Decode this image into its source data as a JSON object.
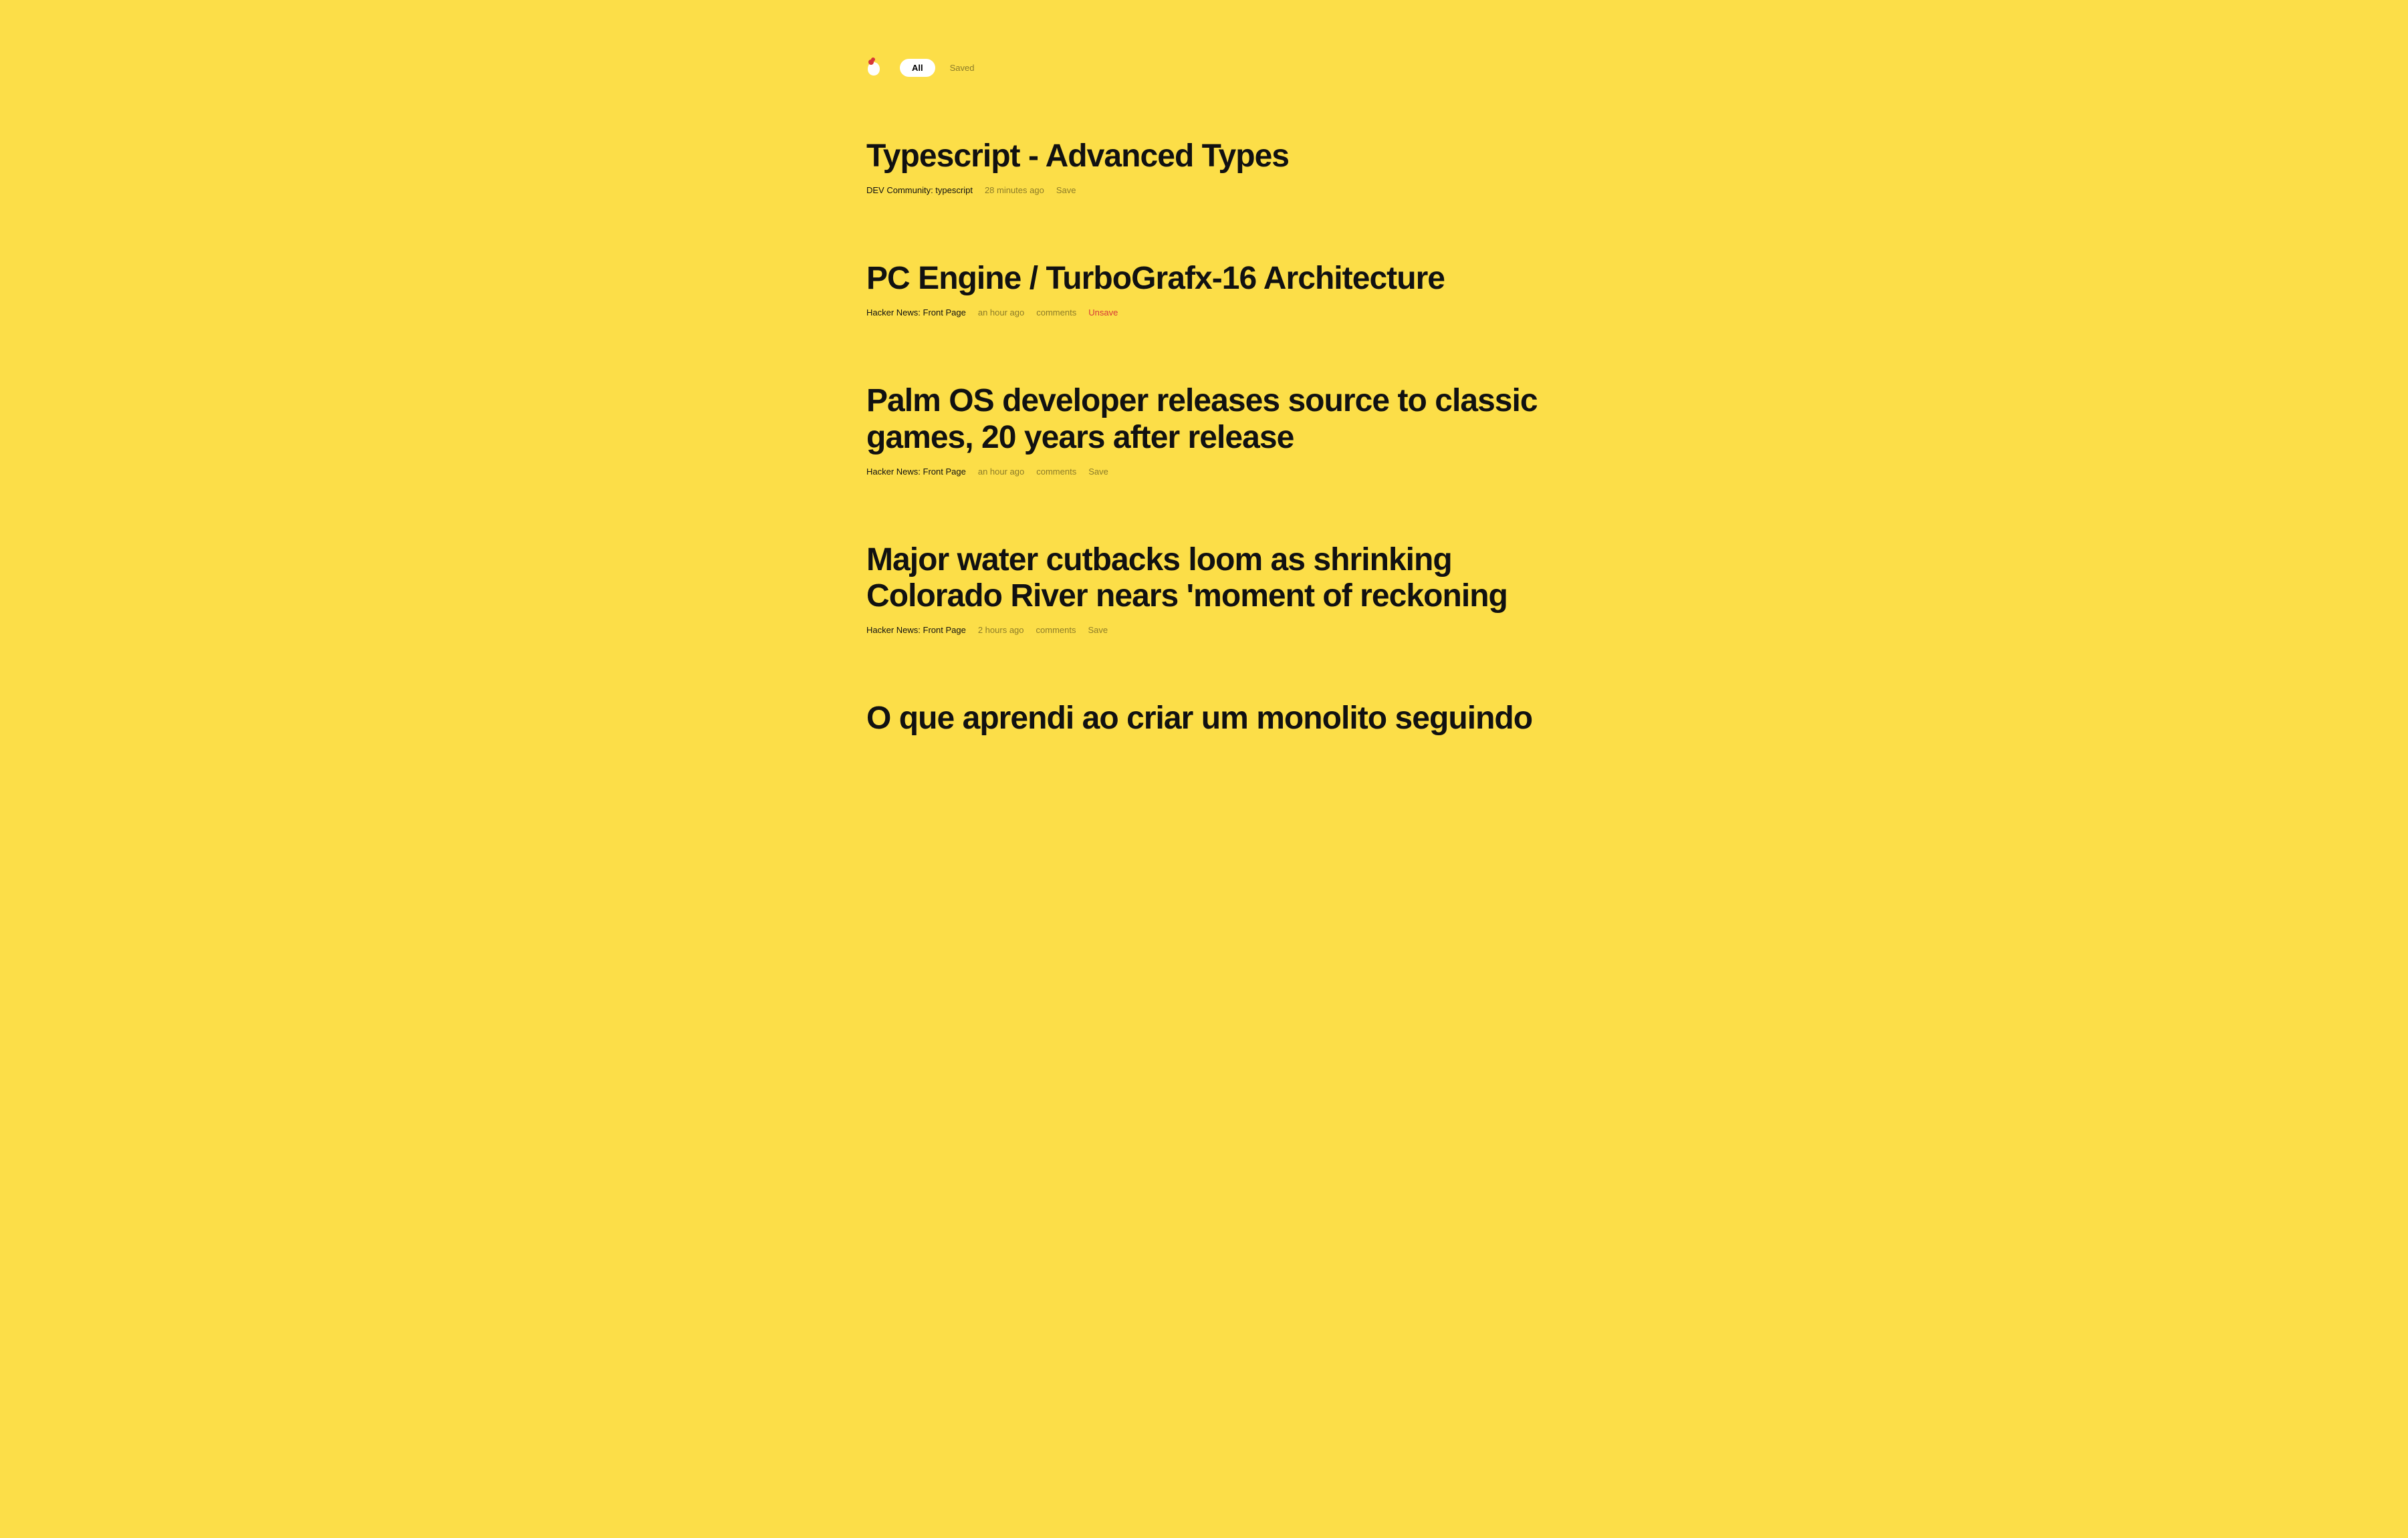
{
  "tabs": {
    "all": "All",
    "saved": "Saved"
  },
  "articles": [
    {
      "title": "Typescript - Advanced Types",
      "source": "DEV Community: typescript",
      "time": "28 minutes ago",
      "comments": null,
      "save_label": "Save",
      "saved": false
    },
    {
      "title": "PC Engine / TurboGrafx-16 Architecture",
      "source": "Hacker News: Front Page",
      "time": "an hour ago",
      "comments": "comments",
      "save_label": "Unsave",
      "saved": true
    },
    {
      "title": "Palm OS developer releases source to classic games, 20 years after release",
      "source": "Hacker News: Front Page",
      "time": "an hour ago",
      "comments": "comments",
      "save_label": "Save",
      "saved": false
    },
    {
      "title": "Major water cutbacks loom as shrinking Colorado River nears 'moment of reckoning",
      "source": "Hacker News: Front Page",
      "time": "2 hours ago",
      "comments": "comments",
      "save_label": "Save",
      "saved": false
    },
    {
      "title": "O que aprendi ao criar um monolito seguindo",
      "source": "",
      "time": "",
      "comments": null,
      "save_label": "",
      "saved": false
    }
  ]
}
